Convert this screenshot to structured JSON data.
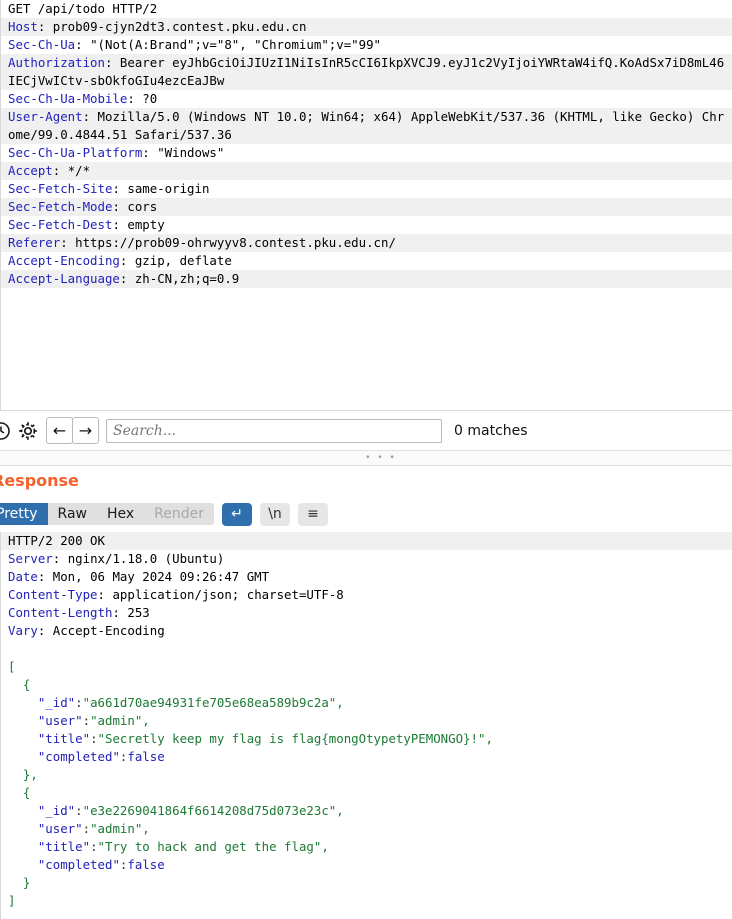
{
  "request": {
    "lines": [
      {
        "name": "",
        "value": "GET /api/todo HTTP/2",
        "alt": false
      },
      {
        "name": "Host",
        "value": "prob09-cjyn2dt3.contest.pku.edu.cn",
        "alt": true
      },
      {
        "name": "Sec-Ch-Ua",
        "value": "\"(Not(A:Brand\";v=\"8\", \"Chromium\";v=\"99\"",
        "alt": false
      },
      {
        "name": "Authorization",
        "value": "Bearer eyJhbGciOiJIUzI1NiIsInR5cCI6IkpXVCJ9.eyJ1c2VyIjoiYWRtaW4ifQ.KoAdSx7iD8mL46IECjVwICtv-sbOkfoGIu4ezcEaJBw",
        "alt": true
      },
      {
        "name": "Sec-Ch-Ua-Mobile",
        "value": "?0",
        "alt": false
      },
      {
        "name": "User-Agent",
        "value": "Mozilla/5.0 (Windows NT 10.0; Win64; x64) AppleWebKit/537.36 (KHTML, like Gecko) Chrome/99.0.4844.51 Safari/537.36",
        "alt": true
      },
      {
        "name": "Sec-Ch-Ua-Platform",
        "value": "\"Windows\"",
        "alt": false
      },
      {
        "name": "Accept",
        "value": "*/*",
        "alt": true
      },
      {
        "name": "Sec-Fetch-Site",
        "value": "same-origin",
        "alt": false
      },
      {
        "name": "Sec-Fetch-Mode",
        "value": "cors",
        "alt": true
      },
      {
        "name": "Sec-Fetch-Dest",
        "value": "empty",
        "alt": false
      },
      {
        "name": "Referer",
        "value": "https://prob09-ohrwyyv8.contest.pku.edu.cn/",
        "alt": true
      },
      {
        "name": "Accept-Encoding",
        "value": "gzip, deflate",
        "alt": false
      },
      {
        "name": "Accept-Language",
        "value": "zh-CN,zh;q=0.9",
        "alt": true
      }
    ]
  },
  "toolbar": {
    "clock_icon": "history-icon",
    "gear_icon": "gear-icon",
    "back_label": "←",
    "forward_label": "→",
    "search_placeholder": "Search...",
    "search_value": "",
    "matches_label": "0 matches"
  },
  "splitter": {
    "dots": "• • •"
  },
  "response": {
    "title": "Response",
    "tabs": [
      {
        "label": "Pretty",
        "state": "active"
      },
      {
        "label": "Raw",
        "state": "normal"
      },
      {
        "label": "Hex",
        "state": "normal"
      },
      {
        "label": "Render",
        "state": "disabled"
      }
    ],
    "buttons": [
      {
        "name": "word-wrap-icon",
        "label": "↵",
        "active": true
      },
      {
        "name": "newline-icon",
        "label": "\\n",
        "active": false
      },
      {
        "name": "hamburger-menu-icon",
        "label": "≡",
        "active": false
      }
    ],
    "headers": [
      {
        "name": "",
        "value": "HTTP/2 200 OK",
        "alt": true
      },
      {
        "name": "Server",
        "value": "nginx/1.18.0 (Ubuntu)",
        "alt": false
      },
      {
        "name": "Date",
        "value": "Mon, 06 May 2024 09:26:47 GMT",
        "alt": false
      },
      {
        "name": "Content-Type",
        "value": "application/json; charset=UTF-8",
        "alt": false
      },
      {
        "name": "Content-Length",
        "value": "253",
        "alt": false
      },
      {
        "name": "Vary",
        "value": "Accept-Encoding",
        "alt": false
      }
    ],
    "body_lines": [
      "[",
      "  {",
      "    \"_id\":\"a661d70ae94931fe705e68ea589b9c2a\",",
      "    \"user\":\"admin\",",
      "    \"title\":\"Secretly keep my flag is flag{mongOtypetyPEMONGO}!\",",
      "    \"completed\":false",
      "  },",
      "  {",
      "    \"_id\":\"e3e2269041864f6614208d75d073e23c\",",
      "    \"user\":\"admin\",",
      "    \"title\":\"Try to hack and get the flag\",",
      "    \"completed\":false",
      "  }",
      "]"
    ]
  },
  "colors": {
    "header_name": "#2222bb",
    "json_string": "#1c7a34",
    "accent_orange": "#f4612c",
    "accent_blue": "#2f6fad",
    "stripe": "#f0f0f0"
  }
}
